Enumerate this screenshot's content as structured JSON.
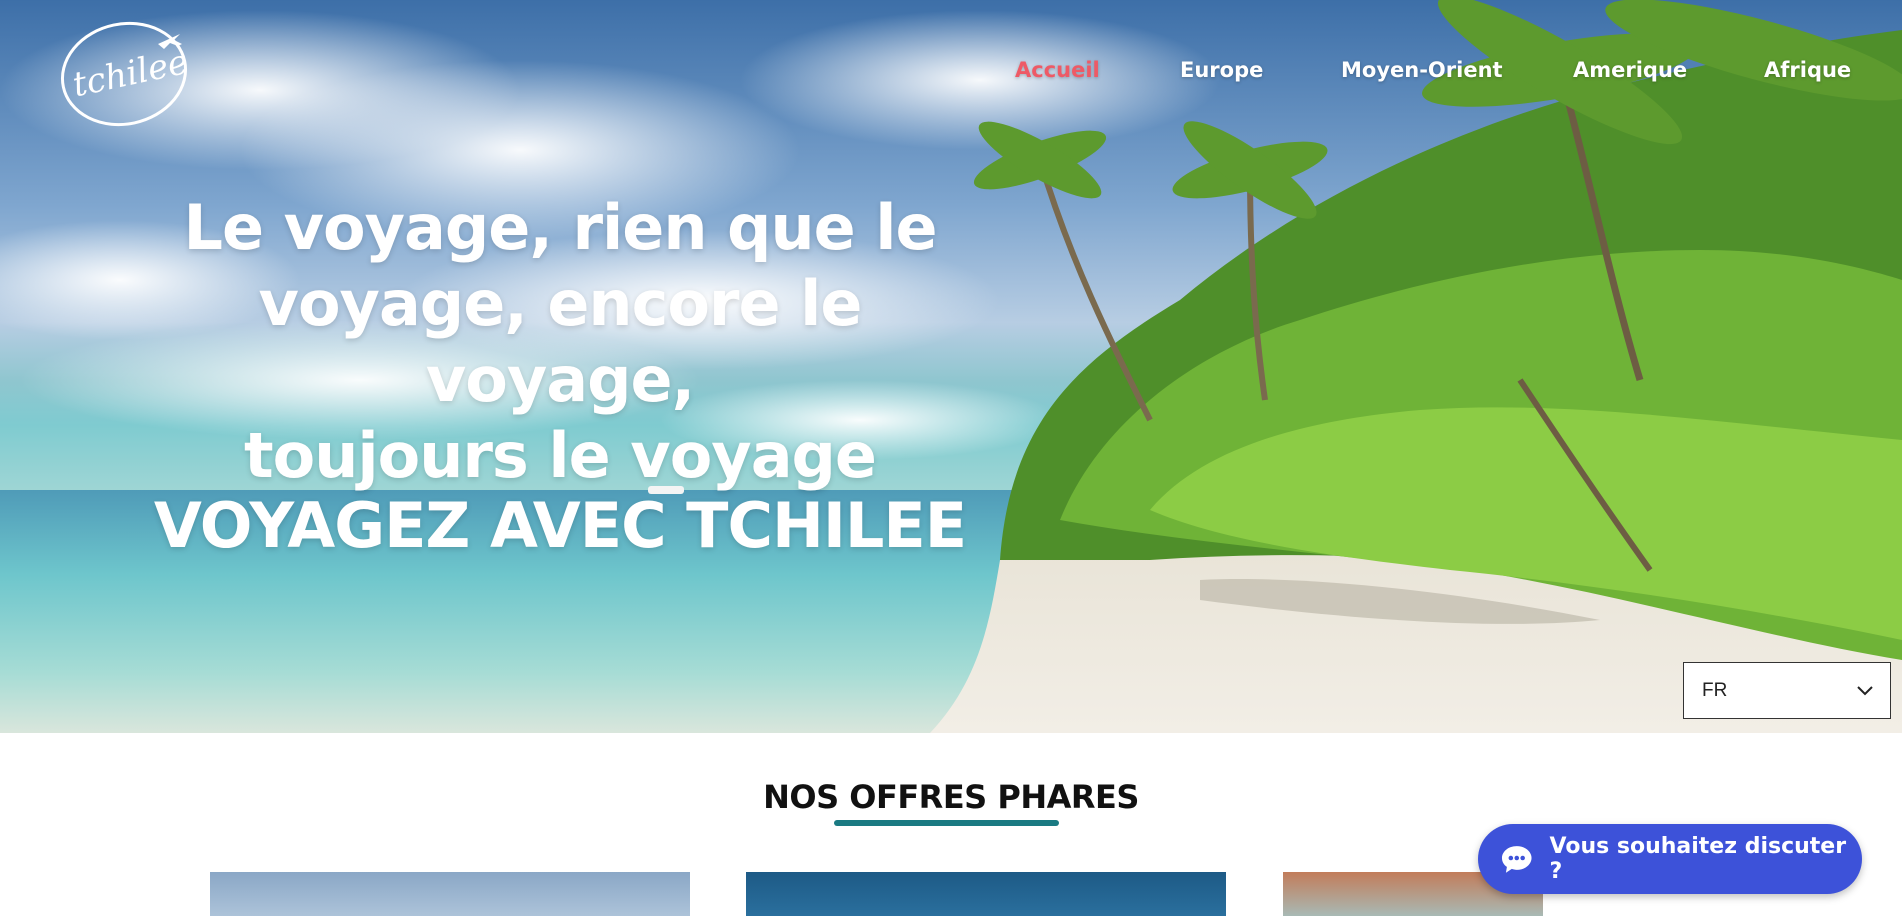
{
  "brand": {
    "logo_text": "tchilee",
    "logo_icon": "airplane-circle-logo"
  },
  "nav": {
    "items": [
      {
        "label": "Accueil",
        "active": true
      },
      {
        "label": "Europe",
        "active": false
      },
      {
        "label": "Moyen-Orient",
        "active": false
      },
      {
        "label": "Amerique",
        "active": false
      },
      {
        "label": "Afrique",
        "active": false
      }
    ]
  },
  "hero": {
    "headline_lines": [
      "Le voyage, rien que le",
      "voyage, encore le voyage,",
      "toujours le voyage"
    ],
    "subheadline": "VOYAGEZ AVEC TCHILEE"
  },
  "language": {
    "selected": "FR",
    "icon": "chevron-down-icon"
  },
  "offers": {
    "title": "NOS OFFRES PHARES"
  },
  "chat": {
    "label": "Vous souhaitez discuter ?",
    "icon": "chat-bubble-icon"
  },
  "colors": {
    "accent_active": "#ee5a66",
    "underline": "#1a7a82",
    "chat": "#3d52d9"
  }
}
